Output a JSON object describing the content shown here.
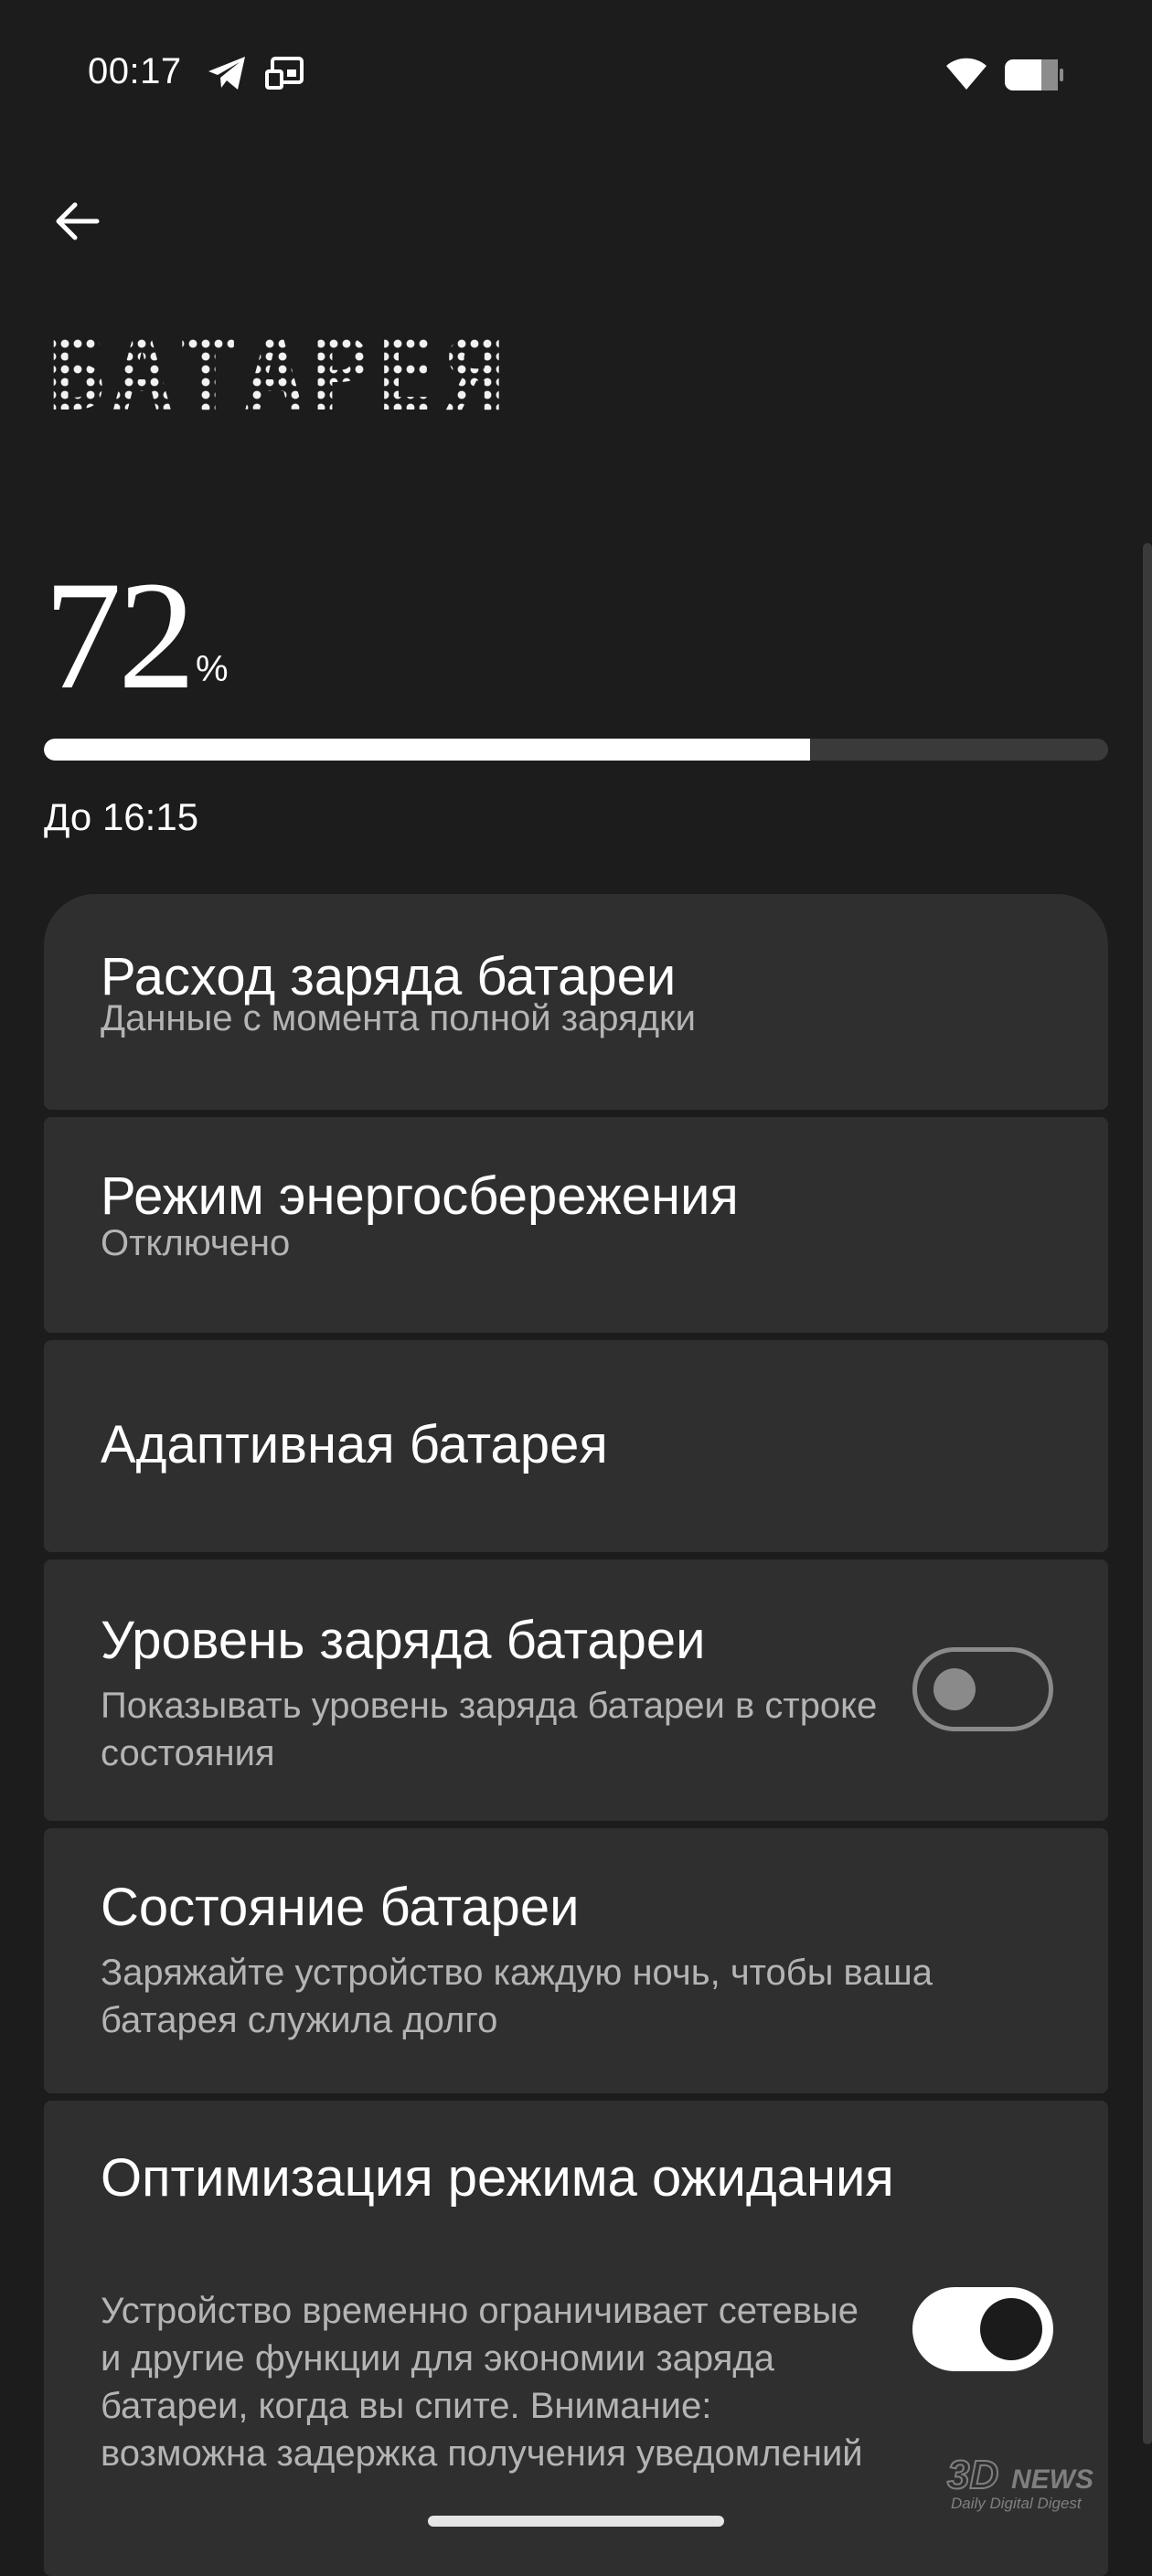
{
  "status_bar": {
    "time": "00:17",
    "icons": [
      "telegram-icon",
      "cast-icon",
      "wifi-icon",
      "battery-icon"
    ]
  },
  "header": {
    "back_icon": "arrow-left-icon",
    "title": "БАТАРЕЯ"
  },
  "battery": {
    "level": "72",
    "unit": "%",
    "level_fraction": 0.72,
    "estimate": "До 16:15"
  },
  "items": [
    {
      "title": "Расход заряда батареи",
      "subtitle": "Данные с момента полной зарядки"
    },
    {
      "title": "Режим энергосбережения",
      "subtitle": "Отключено"
    },
    {
      "title": "Адаптивная батарея"
    },
    {
      "title": "Уровень заряда батареи",
      "subtitle": "Показывать уровень заряда батареи в строке состояния",
      "toggle": false
    },
    {
      "title": "Состояние батареи",
      "subtitle": "Заряжайте устройство каждую ночь, чтобы ваша батарея служила долго"
    },
    {
      "title": "Оптимизация режима ожидания",
      "subtitle": "Устройство временно ограничивает сетевые и другие функции для экономии заряда батареи, когда вы спите. Внимание: возможна задержка получения уведомлений",
      "toggle": true
    }
  ],
  "watermark": {
    "brand": "3DNEWS",
    "tagline": "Daily Digital Digest"
  },
  "colors": {
    "background": "#1c1c1c",
    "card": "#2f2f2f",
    "accent": "#ffffff",
    "secondary_text": "#b4b4b4",
    "track": "#3a3a3a"
  }
}
